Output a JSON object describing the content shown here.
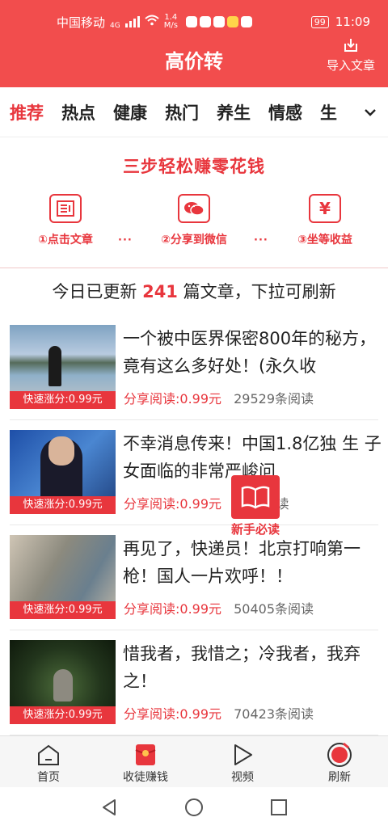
{
  "status_bar": {
    "carrier": "中国移动",
    "network": "4G",
    "speed_value": "1.4",
    "speed_unit": "M/s",
    "battery": "99",
    "time": "11:09"
  },
  "header": {
    "title": "高价转",
    "import_label": "导入文章"
  },
  "tabs": [
    {
      "label": "推荐",
      "active": true
    },
    {
      "label": "热点"
    },
    {
      "label": "健康"
    },
    {
      "label": "热门"
    },
    {
      "label": "养生"
    },
    {
      "label": "情感"
    },
    {
      "label": "生"
    }
  ],
  "promo": {
    "title": "三步轻松赚零花钱",
    "steps": [
      {
        "label": "①点击文章",
        "icon": "article-icon"
      },
      {
        "label": "②分享到微信",
        "icon": "wechat-icon"
      },
      {
        "label": "③坐等收益",
        "icon": "yuan-icon"
      }
    ],
    "dots": "···"
  },
  "update_banner": {
    "prefix": "今日已更新",
    "count": "241",
    "suffix": "篇文章，下拉可刷新"
  },
  "articles": [
    {
      "title": "一个被中医界保密800年的秘方，竟有这么多好处！(永久收",
      "tag": "快速涨分:0.99元",
      "price": "分享阅读:0.99元",
      "reads": "29529条阅读"
    },
    {
      "title": " 不幸消息传来！中国1.8亿独 生 子 女面临的非常严峻问",
      "tag": "快速涨分:0.99元",
      "price": "分享阅读:0.99元",
      "reads": "35条阅读"
    },
    {
      "title": " 再见了，快递员！北京打响第一枪！国人一片欢呼！！",
      "tag": "快速涨分:0.99元",
      "price": "分享阅读:0.99元",
      "reads": "50405条阅读"
    },
    {
      "title": "惜我者，我惜之；冷我者，我弃之！",
      "tag": "快速涨分:0.99元",
      "price": "分享阅读:0.99元",
      "reads": "70423条阅读"
    }
  ],
  "floating_badge": {
    "label": "新手必读"
  },
  "bottom_nav": [
    {
      "label": "首页"
    },
    {
      "label": "收徒赚钱"
    },
    {
      "label": "视频"
    },
    {
      "label": "刷新"
    }
  ],
  "colors": {
    "accent": "#e8363d",
    "header": "#f24d4d"
  }
}
